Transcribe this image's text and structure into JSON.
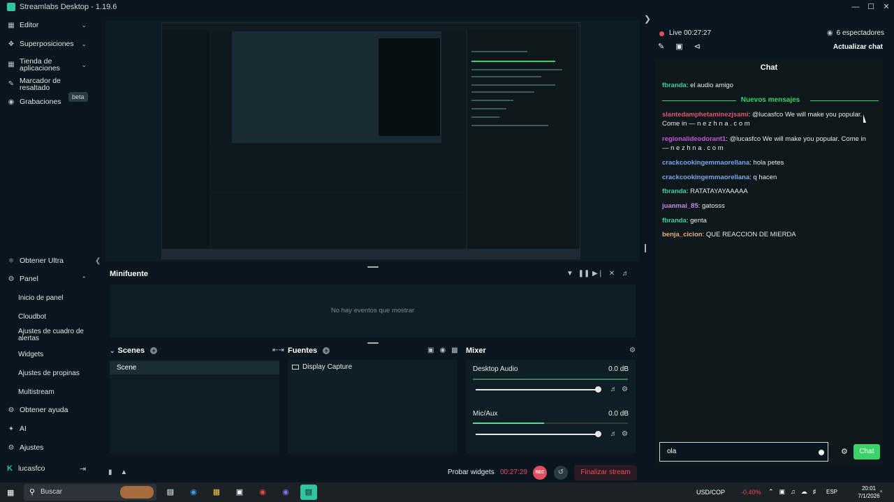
{
  "window": {
    "title": "Streamlabs Desktop - 1.19.6"
  },
  "sidebar": {
    "items": [
      {
        "label": "Editor"
      },
      {
        "label": "Superposiciones"
      },
      {
        "label": "Tienda de aplicaciones"
      },
      {
        "label": "Marcador de resaltado",
        "badge": "beta"
      },
      {
        "label": "Grabaciones"
      },
      {
        "label": "Obtener Ultra"
      },
      {
        "label": "Panel"
      }
    ],
    "sub_items": [
      {
        "label": "Inicio de panel"
      },
      {
        "label": "Cloudbot"
      },
      {
        "label": "Ajustes de cuadro de alertas"
      },
      {
        "label": "Widgets"
      },
      {
        "label": "Ajustes de propinas"
      },
      {
        "label": "Multistream"
      }
    ],
    "bottom": [
      {
        "label": "Obtener ayuda"
      },
      {
        "label": "AI"
      },
      {
        "label": "Ajustes"
      }
    ],
    "user": "lucasfco"
  },
  "minifuente": {
    "title": "Minifuente",
    "empty": "No hay eventos que mostrar"
  },
  "scenes": {
    "title": "Scenes",
    "items": [
      "Scene"
    ]
  },
  "sources": {
    "title": "Fuentes",
    "items": [
      "Display Capture"
    ]
  },
  "mixer": {
    "title": "Mixer",
    "channels": [
      {
        "name": "Desktop Audio",
        "db": "0.0 dB",
        "level": 1.0
      },
      {
        "name": "Mic/Aux",
        "db": "0.0 dB",
        "level": 1.0
      }
    ]
  },
  "footer": {
    "widgets_label": "Probar widgets",
    "timer": "00:27:29",
    "rec": "REC",
    "end_stream": "Finalizar stream"
  },
  "live": {
    "status": "Live 00:27:27",
    "viewers": "6 espectadores",
    "refresh": "Actualizar chat"
  },
  "chat": {
    "title": "Chat",
    "new_messages": "Nuevos mensajes",
    "messages": [
      {
        "user": "fbranda",
        "text": ": el audio amigo",
        "color": "#3bd3a0"
      },
      {
        "user": "slantedamphetaminezjsami",
        "text": ": @lucasfco We will make you popular. Come in — n e z h n a . c o m",
        "color": "#e0566a"
      },
      {
        "user": "regionalideodorant1",
        "text": ": @lucasfco We will make you popular. Come in — n e z h n a . c o m",
        "color": "#c956d8"
      },
      {
        "user": "crackcookingemmaorellana",
        "text": ": hola petes",
        "color": "#7fa6e8"
      },
      {
        "user": "crackcookingemmaorellana",
        "text": ": q hacen",
        "color": "#7fa6e8"
      },
      {
        "user": "fbranda",
        "text": ": RATATAYAYAAAAA",
        "color": "#3bd3a0"
      },
      {
        "user": "juanmai_85",
        "text": ": gatosss",
        "color": "#c58be8"
      },
      {
        "user": "fbranda",
        "text": ": genta",
        "color": "#3bd3a0"
      },
      {
        "user": "benja_cicion",
        "text": ": QUE REACCION DE MIERDA",
        "color": "#e7b37a"
      }
    ],
    "input_value": "ola",
    "send_label": "Chat"
  },
  "taskbar": {
    "search_placeholder": "Buscar",
    "currency": "USD/COP",
    "change": "-0.40%",
    "lang": "ESP",
    "time": "20:01",
    "date": "7/1/2026"
  }
}
